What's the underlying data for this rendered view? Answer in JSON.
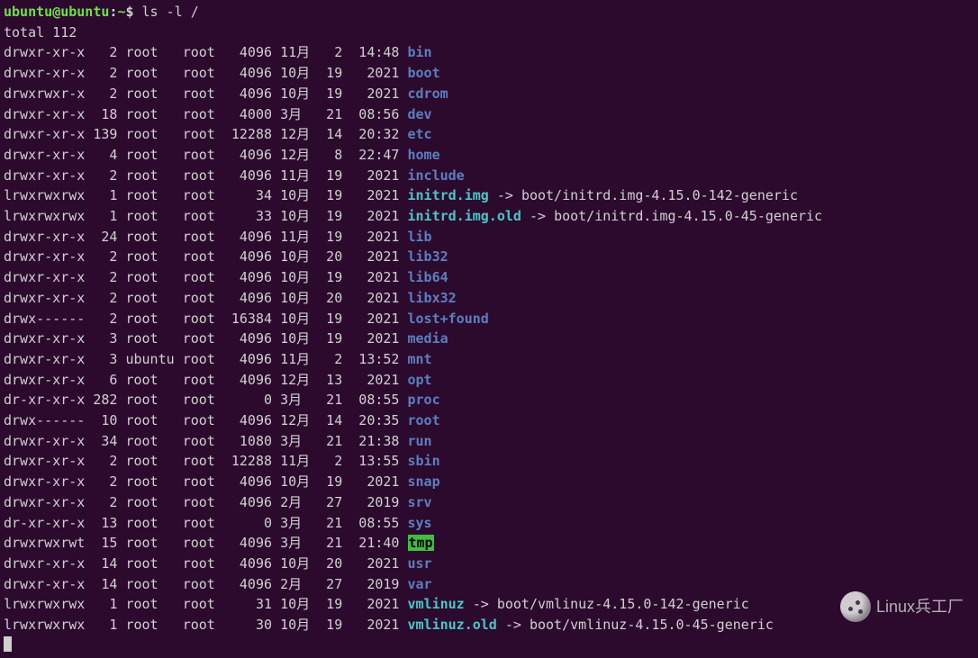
{
  "prompt": {
    "user": "ubuntu",
    "sep": "@",
    "host": "ubuntu",
    "colon": ":",
    "path": "~",
    "dollar": "$ "
  },
  "command": "ls -l /",
  "total_line": "total 112",
  "watermark_text": "Linux兵工厂",
  "entries": [
    {
      "perms": "drwxr-xr-x",
      "links": "2",
      "owner": "root",
      "group": "root",
      "size": "4096",
      "mon": "11月",
      "day": "2",
      "time": "14:48",
      "name": "bin",
      "type": "dir"
    },
    {
      "perms": "drwxr-xr-x",
      "links": "2",
      "owner": "root",
      "group": "root",
      "size": "4096",
      "mon": "10月",
      "day": "19",
      "time": "2021",
      "name": "boot",
      "type": "dir"
    },
    {
      "perms": "drwxrwxr-x",
      "links": "2",
      "owner": "root",
      "group": "root",
      "size": "4096",
      "mon": "10月",
      "day": "19",
      "time": "2021",
      "name": "cdrom",
      "type": "dir"
    },
    {
      "perms": "drwxr-xr-x",
      "links": "18",
      "owner": "root",
      "group": "root",
      "size": "4000",
      "mon": "3月",
      "day": "21",
      "time": "08:56",
      "name": "dev",
      "type": "dir"
    },
    {
      "perms": "drwxr-xr-x",
      "links": "139",
      "owner": "root",
      "group": "root",
      "size": "12288",
      "mon": "12月",
      "day": "14",
      "time": "20:32",
      "name": "etc",
      "type": "dir"
    },
    {
      "perms": "drwxr-xr-x",
      "links": "4",
      "owner": "root",
      "group": "root",
      "size": "4096",
      "mon": "12月",
      "day": "8",
      "time": "22:47",
      "name": "home",
      "type": "dir"
    },
    {
      "perms": "drwxr-xr-x",
      "links": "2",
      "owner": "root",
      "group": "root",
      "size": "4096",
      "mon": "11月",
      "day": "19",
      "time": "2021",
      "name": "include",
      "type": "dir"
    },
    {
      "perms": "lrwxrwxrwx",
      "links": "1",
      "owner": "root",
      "group": "root",
      "size": "34",
      "mon": "10月",
      "day": "19",
      "time": "2021",
      "name": "initrd.img",
      "type": "link",
      "target": "boot/initrd.img-4.15.0-142-generic"
    },
    {
      "perms": "lrwxrwxrwx",
      "links": "1",
      "owner": "root",
      "group": "root",
      "size": "33",
      "mon": "10月",
      "day": "19",
      "time": "2021",
      "name": "initrd.img.old",
      "type": "link",
      "target": "boot/initrd.img-4.15.0-45-generic"
    },
    {
      "perms": "drwxr-xr-x",
      "links": "24",
      "owner": "root",
      "group": "root",
      "size": "4096",
      "mon": "11月",
      "day": "19",
      "time": "2021",
      "name": "lib",
      "type": "dir"
    },
    {
      "perms": "drwxr-xr-x",
      "links": "2",
      "owner": "root",
      "group": "root",
      "size": "4096",
      "mon": "10月",
      "day": "20",
      "time": "2021",
      "name": "lib32",
      "type": "dir"
    },
    {
      "perms": "drwxr-xr-x",
      "links": "2",
      "owner": "root",
      "group": "root",
      "size": "4096",
      "mon": "10月",
      "day": "19",
      "time": "2021",
      "name": "lib64",
      "type": "dir"
    },
    {
      "perms": "drwxr-xr-x",
      "links": "2",
      "owner": "root",
      "group": "root",
      "size": "4096",
      "mon": "10月",
      "day": "20",
      "time": "2021",
      "name": "libx32",
      "type": "dir"
    },
    {
      "perms": "drwx------",
      "links": "2",
      "owner": "root",
      "group": "root",
      "size": "16384",
      "mon": "10月",
      "day": "19",
      "time": "2021",
      "name": "lost+found",
      "type": "dir"
    },
    {
      "perms": "drwxr-xr-x",
      "links": "3",
      "owner": "root",
      "group": "root",
      "size": "4096",
      "mon": "10月",
      "day": "19",
      "time": "2021",
      "name": "media",
      "type": "dir"
    },
    {
      "perms": "drwxr-xr-x",
      "links": "3",
      "owner": "ubuntu",
      "group": "root",
      "size": "4096",
      "mon": "11月",
      "day": "2",
      "time": "13:52",
      "name": "mnt",
      "type": "dir"
    },
    {
      "perms": "drwxr-xr-x",
      "links": "6",
      "owner": "root",
      "group": "root",
      "size": "4096",
      "mon": "12月",
      "day": "13",
      "time": "2021",
      "name": "opt",
      "type": "dir"
    },
    {
      "perms": "dr-xr-xr-x",
      "links": "282",
      "owner": "root",
      "group": "root",
      "size": "0",
      "mon": "3月",
      "day": "21",
      "time": "08:55",
      "name": "proc",
      "type": "dir"
    },
    {
      "perms": "drwx------",
      "links": "10",
      "owner": "root",
      "group": "root",
      "size": "4096",
      "mon": "12月",
      "day": "14",
      "time": "20:35",
      "name": "root",
      "type": "dir"
    },
    {
      "perms": "drwxr-xr-x",
      "links": "34",
      "owner": "root",
      "group": "root",
      "size": "1080",
      "mon": "3月",
      "day": "21",
      "time": "21:38",
      "name": "run",
      "type": "dir"
    },
    {
      "perms": "drwxr-xr-x",
      "links": "2",
      "owner": "root",
      "group": "root",
      "size": "12288",
      "mon": "11月",
      "day": "2",
      "time": "13:55",
      "name": "sbin",
      "type": "dir"
    },
    {
      "perms": "drwxr-xr-x",
      "links": "2",
      "owner": "root",
      "group": "root",
      "size": "4096",
      "mon": "10月",
      "day": "19",
      "time": "2021",
      "name": "snap",
      "type": "dir"
    },
    {
      "perms": "drwxr-xr-x",
      "links": "2",
      "owner": "root",
      "group": "root",
      "size": "4096",
      "mon": "2月",
      "day": "27",
      "time": "2019",
      "name": "srv",
      "type": "dir"
    },
    {
      "perms": "dr-xr-xr-x",
      "links": "13",
      "owner": "root",
      "group": "root",
      "size": "0",
      "mon": "3月",
      "day": "21",
      "time": "08:55",
      "name": "sys",
      "type": "dir"
    },
    {
      "perms": "drwxrwxrwt",
      "links": "15",
      "owner": "root",
      "group": "root",
      "size": "4096",
      "mon": "3月",
      "day": "21",
      "time": "21:40",
      "name": "tmp",
      "type": "sticky"
    },
    {
      "perms": "drwxr-xr-x",
      "links": "14",
      "owner": "root",
      "group": "root",
      "size": "4096",
      "mon": "10月",
      "day": "20",
      "time": "2021",
      "name": "usr",
      "type": "dir"
    },
    {
      "perms": "drwxr-xr-x",
      "links": "14",
      "owner": "root",
      "group": "root",
      "size": "4096",
      "mon": "2月",
      "day": "27",
      "time": "2019",
      "name": "var",
      "type": "dir"
    },
    {
      "perms": "lrwxrwxrwx",
      "links": "1",
      "owner": "root",
      "group": "root",
      "size": "31",
      "mon": "10月",
      "day": "19",
      "time": "2021",
      "name": "vmlinuz",
      "type": "link",
      "target": "boot/vmlinuz-4.15.0-142-generic"
    },
    {
      "perms": "lrwxrwxrwx",
      "links": "1",
      "owner": "root",
      "group": "root",
      "size": "30",
      "mon": "10月",
      "day": "19",
      "time": "2021",
      "name": "vmlinuz.old",
      "type": "link",
      "target": "boot/vmlinuz-4.15.0-45-generic"
    }
  ]
}
